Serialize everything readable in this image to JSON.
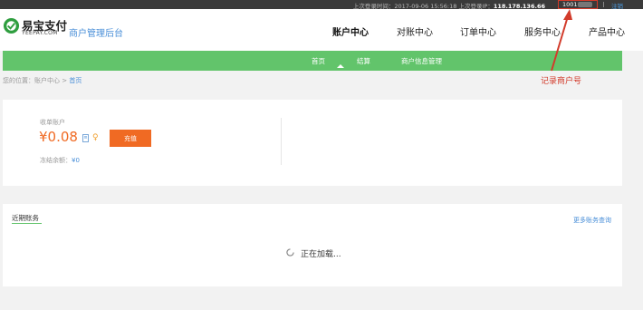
{
  "topbar": {
    "last_login_label": "上次登录时间：",
    "last_login_time": "2017-09-06 15:56:18",
    "last_ip_label": "上次登录IP：",
    "last_ip": "118.178.136.66",
    "account_prefix": "1001",
    "account_suffix": "98",
    "logout": "注销"
  },
  "header": {
    "logo_cn": "易宝支付",
    "logo_en": "YEEPAY.COM",
    "subtitle": "商户管理后台",
    "nav": [
      "账户中心",
      "对账中心",
      "订单中心",
      "服务中心",
      "产品中心"
    ],
    "active_nav": "账户中心"
  },
  "subnav": {
    "tabs": [
      "首页",
      "结算",
      "商户信息管理"
    ],
    "active_tab": "结算"
  },
  "breadcrumb": {
    "prefix": "您的位置：账户中心 >",
    "current": "首页"
  },
  "annotation": {
    "text": "记录商户号",
    "color": "#d23b2b"
  },
  "account": {
    "label": "收单账户",
    "balance": "¥0.08",
    "recharge_button": "充值",
    "frozen_label": "冻结余额：",
    "frozen_value": "¥0"
  },
  "recent": {
    "title": "近期账务",
    "more_link": "更多账务查询",
    "loading": "正在加载..."
  },
  "colors": {
    "brand_green": "#62c46b",
    "accent_orange": "#f06a23",
    "link_blue": "#4a8fd8",
    "topbar_bg": "#3a3a3a"
  }
}
